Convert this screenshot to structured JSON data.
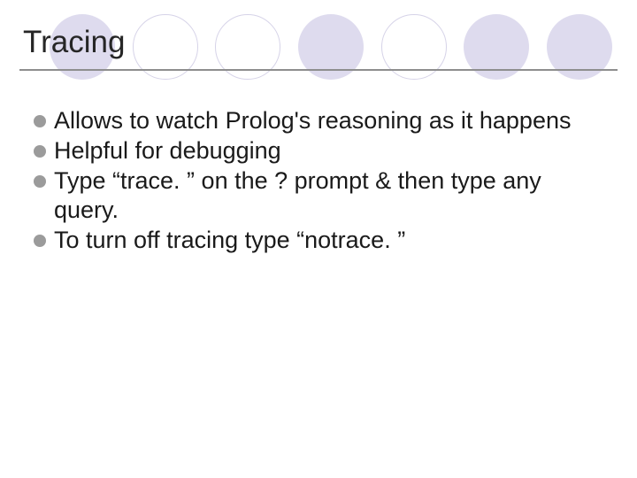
{
  "slide": {
    "title": "Tracing",
    "bullets": [
      "Allows to watch Prolog's reasoning as it happens",
      "Helpful for debugging",
      "Type “trace. ” on the ? prompt & then type any query.",
      "To turn off tracing type “notrace. ”"
    ]
  }
}
